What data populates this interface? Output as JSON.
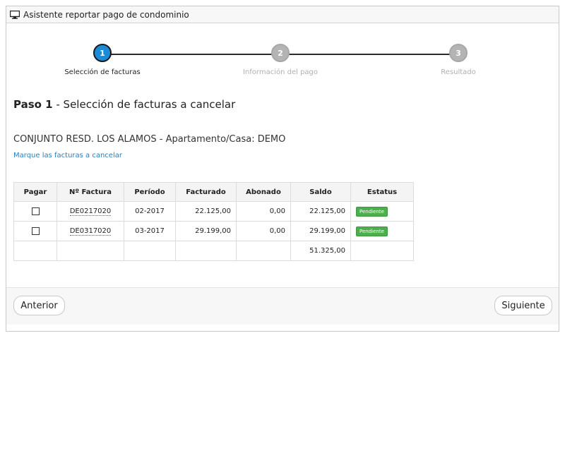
{
  "window": {
    "title": "Asistente reportar pago de condominio",
    "icon": "monitor-icon"
  },
  "wizard": {
    "steps": [
      {
        "number": "1",
        "label": "Selección de facturas",
        "state": "active"
      },
      {
        "number": "2",
        "label": "Información del pago",
        "state": "inactive"
      },
      {
        "number": "3",
        "label": "Resultado",
        "state": "inactive"
      }
    ],
    "active_color": "#1b8bd6",
    "inactive_color": "#b4b4b4"
  },
  "heading": {
    "bold": "Paso 1",
    "rest": " - Selección de facturas a cancelar"
  },
  "building": "CONJUNTO RESD. LOS ALAMOS - Apartamento/Casa: DEMO",
  "instruction": "Marque las facturas a cancelar",
  "table": {
    "headers": [
      "Pagar",
      "Nº Factura",
      "Período",
      "Facturado",
      "Abonado",
      "Saldo",
      "Estatus"
    ],
    "rows": [
      {
        "checked": false,
        "invoice": "DE0217020",
        "period": "02-2017",
        "billed": "22.125,00",
        "paid": "0,00",
        "balance": "22.125,00",
        "status": "Pendiente"
      },
      {
        "checked": false,
        "invoice": "DE0317020",
        "period": "03-2017",
        "billed": "29.199,00",
        "paid": "0,00",
        "balance": "29.199,00",
        "status": "Pendiente"
      }
    ],
    "total_balance": "51.325,00",
    "status_color": "#4cae4c"
  },
  "footer": {
    "prev_label": "Anterior",
    "next_label": "Siguiente"
  }
}
